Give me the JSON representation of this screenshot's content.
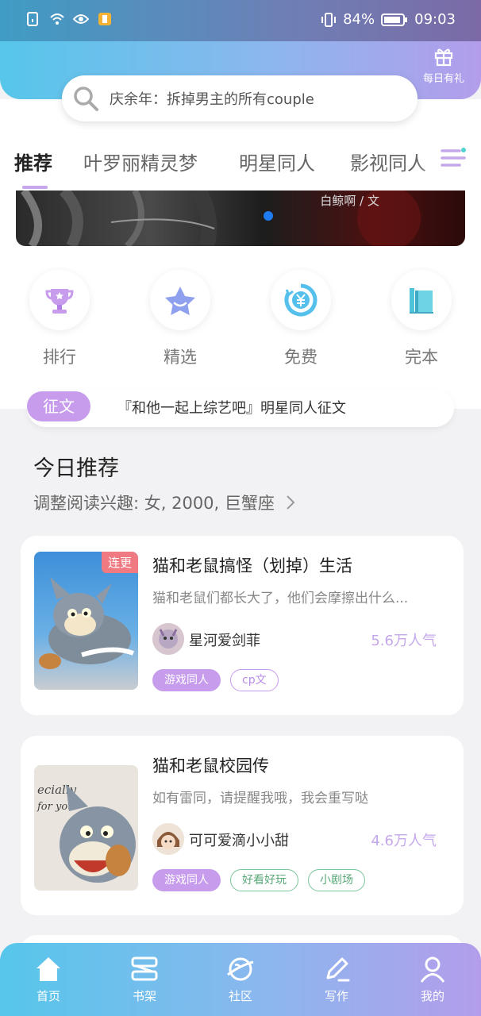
{
  "status_bar": {
    "battery": "84%",
    "time": "09:03"
  },
  "header": {
    "gift_label": "每日有礼",
    "search_placeholder": "庆余年：拆掉男主的所有couple"
  },
  "tabs": [
    {
      "label": "推荐",
      "active": true
    },
    {
      "label": "叶罗丽精灵梦",
      "active": false
    },
    {
      "label": "明星同人",
      "active": false
    },
    {
      "label": "影视同人",
      "active": false
    }
  ],
  "banner": {
    "author": "白鲸啊 / 文"
  },
  "quick_nav": [
    {
      "label": "排行",
      "icon": "trophy-icon"
    },
    {
      "label": "精选",
      "icon": "star-icon"
    },
    {
      "label": "免费",
      "icon": "yuan-icon"
    },
    {
      "label": "完本",
      "icon": "book-icon"
    }
  ],
  "notice": {
    "tag": "征文",
    "text": "『和他一起上综艺吧』明星同人征文"
  },
  "today": {
    "title": "今日推荐",
    "subtitle": "调整阅读兴趣: 女, 2000, 巨蟹座"
  },
  "books": [
    {
      "title": "猫和老鼠搞怪（划掉）生活",
      "desc": "猫和老鼠们都长大了，他们会摩擦出什么...",
      "author": "星河爱剑菲",
      "popularity": "5.6万人气",
      "cover_tag": "连更",
      "tags": [
        {
          "label": "游戏同人"
        },
        {
          "label": "cp文"
        }
      ]
    },
    {
      "title": "猫和老鼠校园传",
      "desc": "如有雷同，请提醒我哦，我会重写哒",
      "author": "可可爱滴小小甜",
      "popularity": "4.6万人气",
      "tags": [
        {
          "label": "游戏同人"
        },
        {
          "label": "好看好玩"
        },
        {
          "label": "小剧场"
        }
      ]
    }
  ],
  "bottom_nav": [
    {
      "label": "首页",
      "icon": "home-icon"
    },
    {
      "label": "书架",
      "icon": "bookshelf-icon"
    },
    {
      "label": "社区",
      "icon": "planet-icon"
    },
    {
      "label": "写作",
      "icon": "pen-icon"
    },
    {
      "label": "我的",
      "icon": "profile-icon"
    }
  ],
  "colors": {
    "accent": "#c79cec",
    "gradient_start": "#56c6ea",
    "gradient_end": "#b39deb",
    "popularity": "#c4a8ea"
  }
}
